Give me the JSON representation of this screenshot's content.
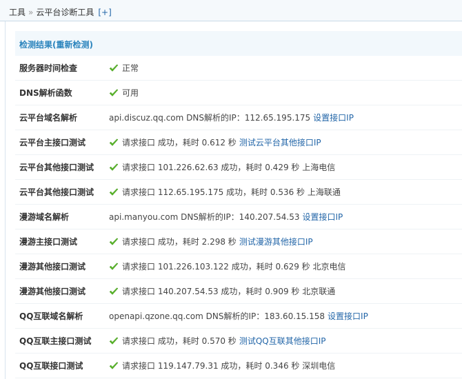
{
  "breadcrumb": {
    "root": "工具",
    "sep": "»",
    "current": "云平台诊断工具",
    "plus": "[+]"
  },
  "panel": {
    "title": "检测结果(重新检测)"
  },
  "rows": [
    {
      "label": "服务器时间检查",
      "ok": true,
      "text": "正常",
      "link": ""
    },
    {
      "label": "DNS解析函数",
      "ok": true,
      "text": "可用",
      "link": ""
    },
    {
      "label": "云平台域名解析",
      "ok": false,
      "text": "api.discuz.qq.com DNS解析的IP：112.65.195.175",
      "link": "设置接口IP"
    },
    {
      "label": "云平台主接口测试",
      "ok": true,
      "text": "请求接口 成功，耗时 0.612 秒",
      "link": "测试云平台其他接口IP"
    },
    {
      "label": "云平台其他接口测试",
      "ok": true,
      "text": "请求接口 101.226.62.63 成功，耗时 0.429 秒 上海电信",
      "link": ""
    },
    {
      "label": "云平台其他接口测试",
      "ok": true,
      "text": "请求接口 112.65.195.175 成功，耗时 0.536 秒 上海联通",
      "link": ""
    },
    {
      "label": "漫游域名解析",
      "ok": false,
      "text": "api.manyou.com DNS解析的IP：140.207.54.53",
      "link": "设置接口IP"
    },
    {
      "label": "漫游主接口测试",
      "ok": true,
      "text": "请求接口 成功，耗时 2.298 秒",
      "link": "测试漫游其他接口IP"
    },
    {
      "label": "漫游其他接口测试",
      "ok": true,
      "text": "请求接口 101.226.103.122 成功，耗时 0.629 秒 北京电信",
      "link": ""
    },
    {
      "label": "漫游其他接口测试",
      "ok": true,
      "text": "请求接口 140.207.54.53 成功，耗时 0.909 秒 北京联通",
      "link": ""
    },
    {
      "label": "QQ互联域名解析",
      "ok": false,
      "text": "openapi.qzone.qq.com DNS解析的IP：183.60.15.158",
      "link": "设置接口IP"
    },
    {
      "label": "QQ互联主接口测试",
      "ok": true,
      "text": "请求接口 成功，耗时 0.570 秒",
      "link": "测试QQ互联其他接口IP"
    },
    {
      "label": "QQ互联接口测试",
      "ok": true,
      "text": "请求接口 119.147.79.31 成功，耗时 0.346 秒 深圳电信",
      "link": ""
    }
  ]
}
